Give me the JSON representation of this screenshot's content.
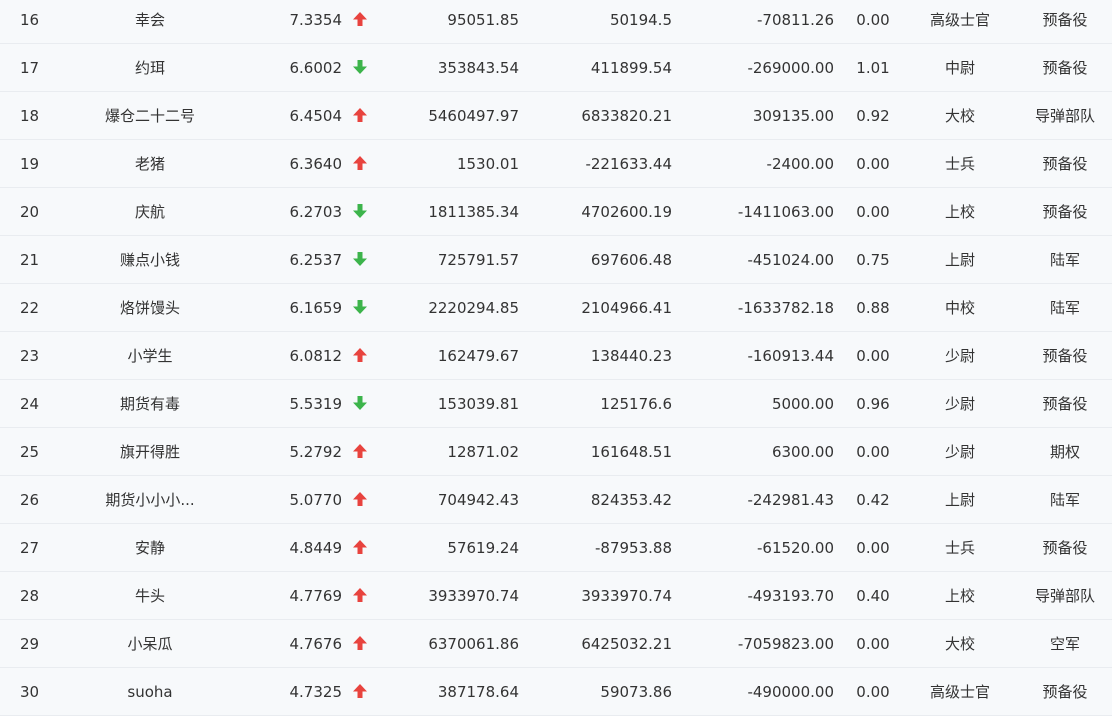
{
  "colors": {
    "up": "#e8433e",
    "down": "#3cb44b"
  },
  "rows": [
    {
      "rank": "16",
      "name": "幸会",
      "score": "7.3354",
      "trend": "up",
      "v1": "95051.85",
      "v2": "50194.5",
      "v3": "-70811.26",
      "ratio": "0.00",
      "military_rank": "高级士官",
      "unit": "预备役"
    },
    {
      "rank": "17",
      "name": "约珥",
      "score": "6.6002",
      "trend": "down",
      "v1": "353843.54",
      "v2": "411899.54",
      "v3": "-269000.00",
      "ratio": "1.01",
      "military_rank": "中尉",
      "unit": "预备役"
    },
    {
      "rank": "18",
      "name": "爆仓二十二号",
      "score": "6.4504",
      "trend": "up",
      "v1": "5460497.97",
      "v2": "6833820.21",
      "v3": "309135.00",
      "ratio": "0.92",
      "military_rank": "大校",
      "unit": "导弹部队"
    },
    {
      "rank": "19",
      "name": "老猪",
      "score": "6.3640",
      "trend": "up",
      "v1": "1530.01",
      "v2": "-221633.44",
      "v3": "-2400.00",
      "ratio": "0.00",
      "military_rank": "士兵",
      "unit": "预备役"
    },
    {
      "rank": "20",
      "name": "庆航",
      "score": "6.2703",
      "trend": "down",
      "v1": "1811385.34",
      "v2": "4702600.19",
      "v3": "-1411063.00",
      "ratio": "0.00",
      "military_rank": "上校",
      "unit": "预备役"
    },
    {
      "rank": "21",
      "name": "赚点小钱",
      "score": "6.2537",
      "trend": "down",
      "v1": "725791.57",
      "v2": "697606.48",
      "v3": "-451024.00",
      "ratio": "0.75",
      "military_rank": "上尉",
      "unit": "陆军"
    },
    {
      "rank": "22",
      "name": "烙饼馒头",
      "score": "6.1659",
      "trend": "down",
      "v1": "2220294.85",
      "v2": "2104966.41",
      "v3": "-1633782.18",
      "ratio": "0.88",
      "military_rank": "中校",
      "unit": "陆军"
    },
    {
      "rank": "23",
      "name": "小学生",
      "score": "6.0812",
      "trend": "up",
      "v1": "162479.67",
      "v2": "138440.23",
      "v3": "-160913.44",
      "ratio": "0.00",
      "military_rank": "少尉",
      "unit": "预备役"
    },
    {
      "rank": "24",
      "name": "期货有毒",
      "score": "5.5319",
      "trend": "down",
      "v1": "153039.81",
      "v2": "125176.6",
      "v3": "5000.00",
      "ratio": "0.96",
      "military_rank": "少尉",
      "unit": "预备役"
    },
    {
      "rank": "25",
      "name": "旗开得胜",
      "score": "5.2792",
      "trend": "up",
      "v1": "12871.02",
      "v2": "161648.51",
      "v3": "6300.00",
      "ratio": "0.00",
      "military_rank": "少尉",
      "unit": "期权"
    },
    {
      "rank": "26",
      "name": "期货小小小...",
      "score": "5.0770",
      "trend": "up",
      "v1": "704942.43",
      "v2": "824353.42",
      "v3": "-242981.43",
      "ratio": "0.42",
      "military_rank": "上尉",
      "unit": "陆军"
    },
    {
      "rank": "27",
      "name": "安静",
      "score": "4.8449",
      "trend": "up",
      "v1": "57619.24",
      "v2": "-87953.88",
      "v3": "-61520.00",
      "ratio": "0.00",
      "military_rank": "士兵",
      "unit": "预备役"
    },
    {
      "rank": "28",
      "name": "牛头",
      "score": "4.7769",
      "trend": "up",
      "v1": "3933970.74",
      "v2": "3933970.74",
      "v3": "-493193.70",
      "ratio": "0.40",
      "military_rank": "上校",
      "unit": "导弹部队"
    },
    {
      "rank": "29",
      "name": "小呆瓜",
      "score": "4.7676",
      "trend": "up",
      "v1": "6370061.86",
      "v2": "6425032.21",
      "v3": "-7059823.00",
      "ratio": "0.00",
      "military_rank": "大校",
      "unit": "空军"
    },
    {
      "rank": "30",
      "name": "suoha",
      "score": "4.7325",
      "trend": "up",
      "v1": "387178.64",
      "v2": "59073.86",
      "v3": "-490000.00",
      "ratio": "0.00",
      "military_rank": "高级士官",
      "unit": "预备役"
    }
  ]
}
